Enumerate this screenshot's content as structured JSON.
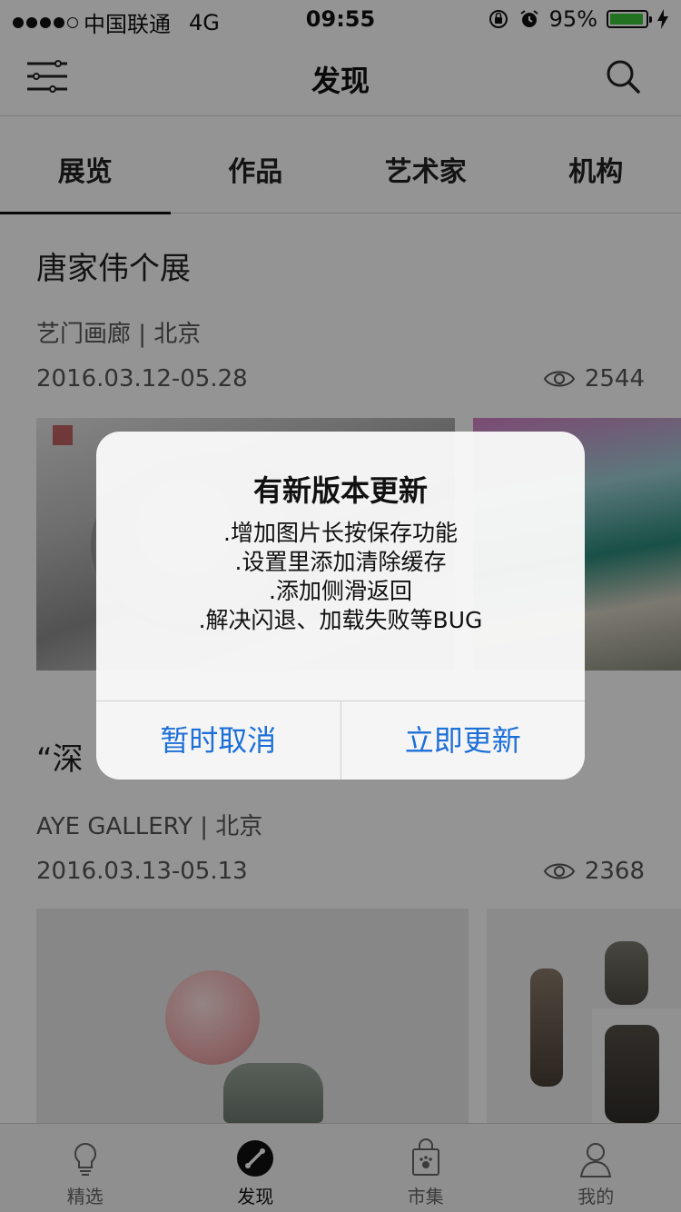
{
  "status_bar": {
    "carrier": "中国联通",
    "network": "4G",
    "time": "09:55",
    "battery": "95%",
    "battery_level": 0.95
  },
  "nav": {
    "title": "发现",
    "menu_icon": "menu-icon",
    "search_icon": "search-icon"
  },
  "tabs": [
    {
      "label": "展览",
      "active": true
    },
    {
      "label": "作品",
      "active": false
    },
    {
      "label": "艺术家",
      "active": false
    },
    {
      "label": "机构",
      "active": false
    }
  ],
  "exhibitions": [
    {
      "title": "唐家伟个展",
      "venue": "艺门画廊 | 北京",
      "dates": "2016.03.12-05.28",
      "views": "2544"
    },
    {
      "title": "“深",
      "venue": "AYE GALLERY | 北京",
      "dates": "2016.03.13-05.13",
      "views": "2368"
    }
  ],
  "alert": {
    "title": "有新版本更新",
    "lines": [
      ".增加图片长按保存功能",
      ".设置里添加清除缓存",
      ".添加侧滑返回",
      ".解决闪退、加载失败等BUG"
    ],
    "cancel": "暂时取消",
    "confirm": "立即更新",
    "accent_color": "#1d6fd8"
  },
  "tabbar": [
    {
      "label": "精选",
      "icon": "lightbulb-icon",
      "active": false
    },
    {
      "label": "发现",
      "icon": "discover-icon",
      "active": true
    },
    {
      "label": "市集",
      "icon": "shopping-bag-icon",
      "active": false
    },
    {
      "label": "我的",
      "icon": "user-icon",
      "active": false
    }
  ]
}
